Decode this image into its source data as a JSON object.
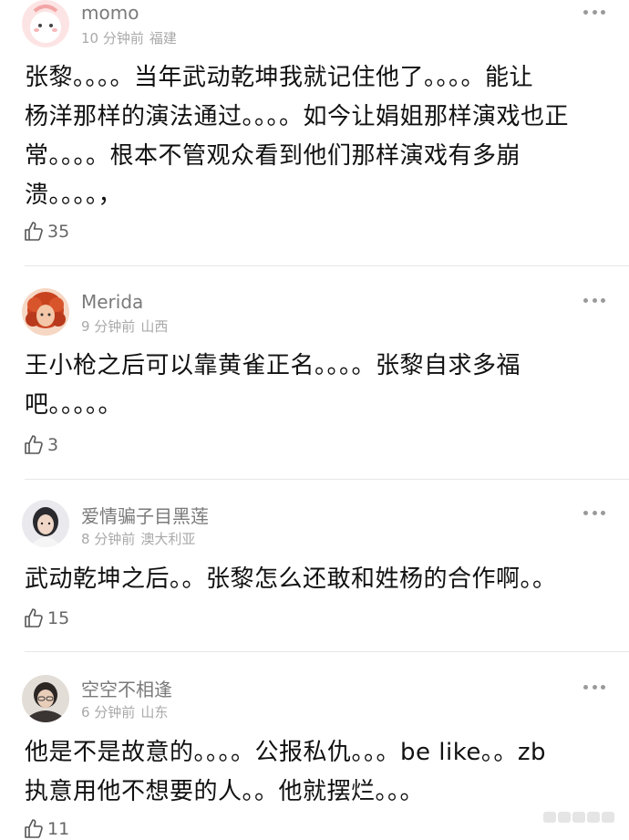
{
  "comments": [
    {
      "username": "momo",
      "time": "10 分钟前",
      "location": "福建",
      "lines": [
        "张黎。。。。当年武动乾坤我就记住他了。。。。能让",
        "杨洋那样的演法通过。。。。如今让娟姐那样演戏也正",
        "常。。。。根本不管观众看到他们那样演戏有多崩",
        "溃。。。。，"
      ],
      "likes": "35"
    },
    {
      "username": "Merida",
      "time": "9 分钟前",
      "location": "山西",
      "lines": [
        "王小枪之后可以靠黄雀正名。。。。张黎自求多福",
        "吧。。。。。"
      ],
      "likes": "3"
    },
    {
      "username": "爱情骗子目黑莲",
      "time": "8 分钟前",
      "location": "澳大利亚",
      "lines": [
        "武动乾坤之后。。张黎怎么还敢和姓杨的合作啊。。"
      ],
      "likes": "15"
    },
    {
      "username": "空空不相逢",
      "time": "6 分钟前",
      "location": "山东",
      "lines": [
        "他是不是故意的。。。。公报私仇。。。be like。。zb",
        "执意用他不想要的人。。他就摆烂。。。"
      ],
      "likes": "11"
    }
  ],
  "icons": {
    "like": "thumbs-up-icon",
    "more": "more-dots-icon"
  },
  "colors": {
    "username": "#7a7a7a",
    "meta": "#a9a9a9",
    "text": "#111111",
    "divider": "#e6e6e6"
  }
}
